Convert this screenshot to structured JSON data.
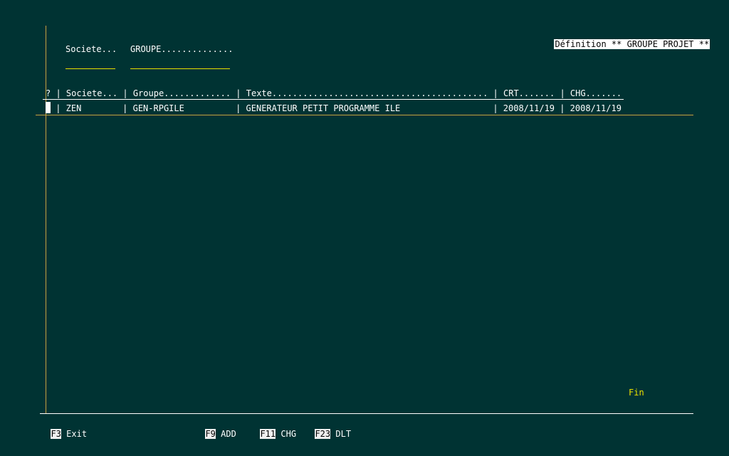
{
  "screen": {
    "title": "Définition ** GROUPE PROJET **"
  },
  "filter": {
    "societe_label": "Societe...",
    "groupe_label": "GROUPE..............",
    "societe_value": "",
    "groupe_value": ""
  },
  "table": {
    "header": "? | Societe... | Groupe............. | Texte.......................................... | CRT....... | CHG.......",
    "rows": [
      {
        "sel": "",
        "line": " | ZEN        | GEN-RPGILE          | GENERATEUR PETIT PROGRAMME ILE                  | 2008/11/19 | 2008/11/19",
        "societe": "ZEN",
        "groupe": "GEN-RPGILE",
        "texte": "GENERATEUR PETIT PROGRAMME ILE",
        "crt": "2008/11/19",
        "chg": "2008/11/19"
      }
    ]
  },
  "status": {
    "end_marker": "Fin"
  },
  "function_keys": [
    {
      "key": "F3",
      "label": "Exit"
    },
    {
      "key": "F9",
      "label": "ADD"
    },
    {
      "key": "F11",
      "label": "CHG"
    },
    {
      "key": "F23",
      "label": "DLT"
    }
  ]
}
